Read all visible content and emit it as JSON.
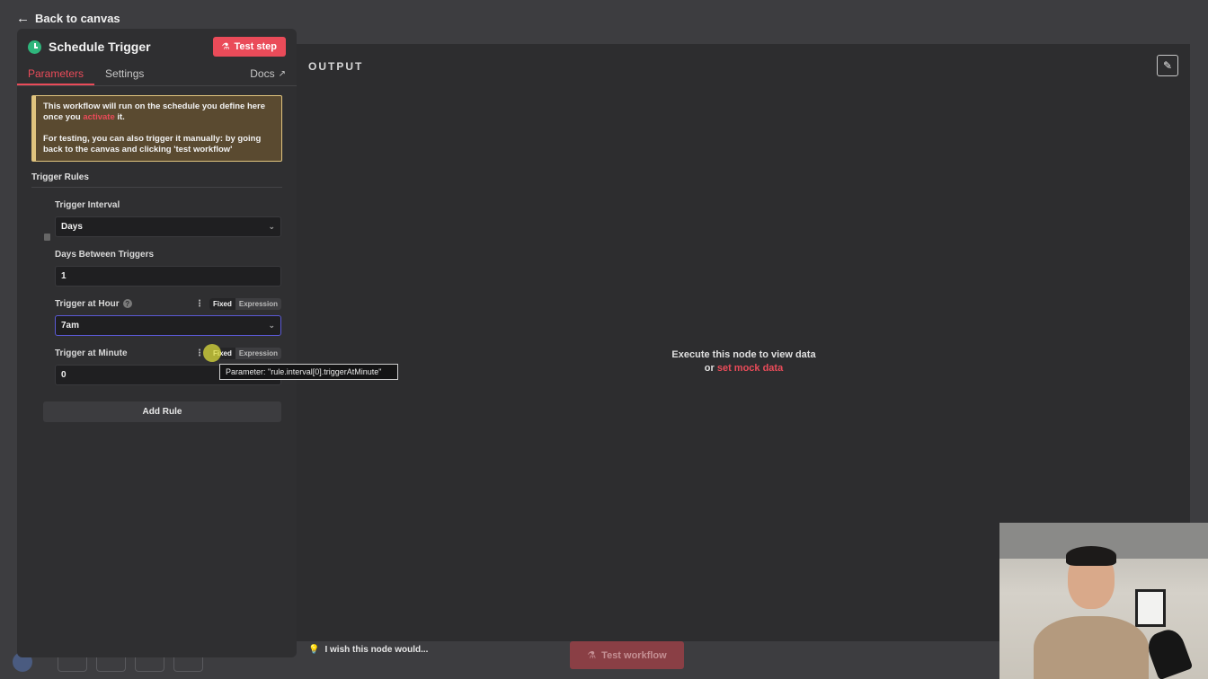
{
  "nav": {
    "back_label": "Back to canvas"
  },
  "node": {
    "title": "Schedule Trigger",
    "test_step_label": "Test step",
    "tabs": [
      {
        "label": "Parameters",
        "active": true
      },
      {
        "label": "Settings",
        "active": false
      }
    ],
    "docs_label": "Docs"
  },
  "notice": {
    "line1_pre": "This workflow will run on the schedule you define here once you ",
    "line1_link": "activate",
    "line1_post": " it.",
    "line2": "For testing, you can also trigger it manually: by going back to the canvas and clicking 'test workflow'"
  },
  "rules": {
    "section_title": "Trigger Rules",
    "interval": {
      "label": "Trigger Interval",
      "value": "Days"
    },
    "days_between": {
      "label": "Days Between Triggers",
      "value": "1"
    },
    "hour": {
      "label": "Trigger at Hour",
      "value": "7am",
      "mode_fixed": "Fixed",
      "mode_expression": "Expression"
    },
    "minute": {
      "label": "Trigger at Minute",
      "value": "0",
      "mode_fixed": "Fixed",
      "mode_expression": "Expression"
    },
    "add_rule_label": "Add Rule",
    "tooltip": "Parameter: \"rule.interval[0].triggerAtMinute\""
  },
  "output": {
    "title": "OUTPUT",
    "empty_line1": "Execute this node to view data",
    "empty_or": "or ",
    "mock_link": "set mock data"
  },
  "footer": {
    "wish_label": "I wish this node would...",
    "test_workflow_label": "Test workflow"
  },
  "colors": {
    "accent": "#ea4b59",
    "trigger_green": "#2fb67c",
    "notice_border": "#e0c47e"
  }
}
